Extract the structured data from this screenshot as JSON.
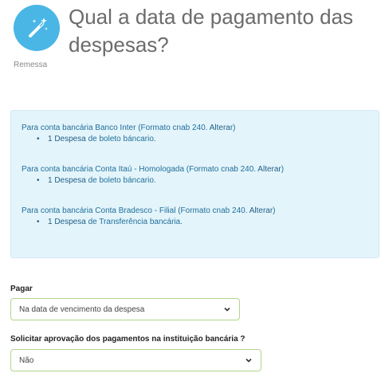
{
  "header": {
    "title": "Qual a data de pagamento das despesas?",
    "subtitle": "Remessa",
    "icon": "magic-wand-icon",
    "icon_color": "#49b6e6"
  },
  "info": {
    "accounts": [
      {
        "prefix": "Para conta bancária ",
        "name": "Banco Inter",
        "format": " (Formato cnab 240. ",
        "action": "Alterar",
        "suffix": ")",
        "bullet_count": "1 Despesa",
        "bullet_rest": " de boleto báncario."
      },
      {
        "prefix": "Para conta bancária ",
        "name": "Conta Itaú - Homologada",
        "format": " (Formato cnab 240. ",
        "action": "Alterar",
        "suffix": ")",
        "bullet_count": "1 Despesa",
        "bullet_rest": " de boleto báncario."
      },
      {
        "prefix": "Para conta bancária ",
        "name": "Conta Bradesco - Filial",
        "format": " (Formato cnab 240. ",
        "action": "Alterar",
        "suffix": ")",
        "bullet_count": "1 Despesa",
        "bullet_rest": " de Transferência bancária."
      }
    ]
  },
  "form": {
    "pagar_label": "Pagar",
    "pagar_value": "Na data de vencimento da despesa",
    "aprovacao_label": "Solicitar aprovação dos pagamentos na instituição bancária ?",
    "aprovacao_value": "Não"
  }
}
